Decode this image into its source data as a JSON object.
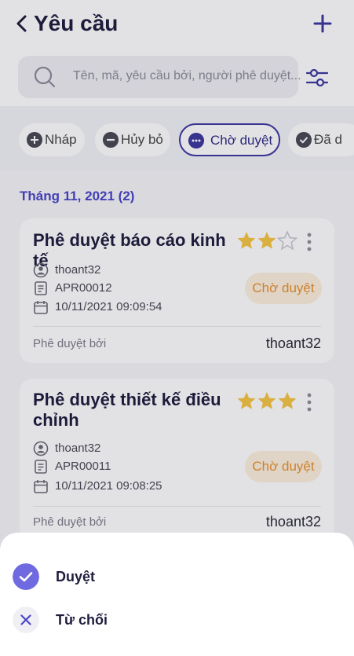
{
  "header": {
    "title": "Yêu cầu"
  },
  "search": {
    "placeholder": "Tên, mã, yêu cầu bởi, người phê duyệt..."
  },
  "filters": [
    {
      "label": "Nháp",
      "icon": "plus-circle-icon"
    },
    {
      "label": "Hủy bỏ",
      "icon": "minus-circle-icon"
    },
    {
      "label": "Chờ duyệt",
      "icon": "more-circle-icon",
      "selected": true
    },
    {
      "label": "Đã d",
      "icon": "check-circle-icon"
    }
  ],
  "section": {
    "title": "Tháng 11, 2021 (2)"
  },
  "requests": [
    {
      "title": "Phê duyệt báo cáo kinh tế",
      "rating": 2,
      "max_rating": 3,
      "requester": "thoant32",
      "code": "APR00012",
      "datetime": "10/11/2021 09:09:54",
      "status": "Chờ duyệt",
      "approved_by_label": "Phê duyệt bởi",
      "approved_by": "thoant32"
    },
    {
      "title": "Phê duyệt thiết kế điều chỉnh",
      "rating": 3,
      "max_rating": 3,
      "requester": "thoant32",
      "code": "APR00011",
      "datetime": "10/11/2021 09:08:25",
      "status": "Chờ duyệt",
      "approved_by_label": "Phê duyệt bởi",
      "approved_by": "thoant32"
    }
  ],
  "action_sheet": {
    "approve_label": "Duyệt",
    "reject_label": "Từ chối"
  },
  "colors": {
    "primary": "#4b45c8",
    "status_text": "#e8922e",
    "status_bg": "#fdf0dc",
    "star": "#f5c542"
  }
}
